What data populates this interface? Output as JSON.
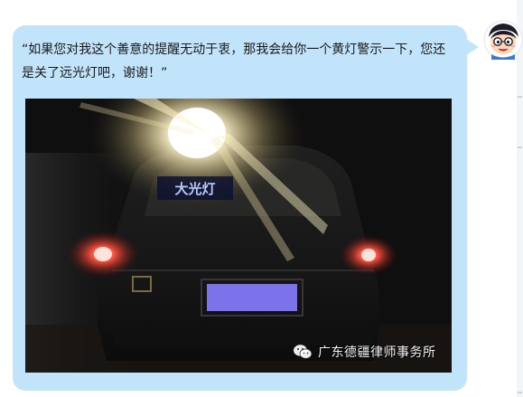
{
  "message": {
    "text": "“如果您对我这个善意的提醒无动于衷，那我会给你一个黄灯警示一下，您还是关了远光灯吧，谢谢！”"
  },
  "photo": {
    "rear_sign_text": "大光灯",
    "watermark_text": "广东德疆律师事务所",
    "watermark_icon": "wechat-icon"
  },
  "avatar": {
    "icon": "cartoon-avatar-icon"
  },
  "colors": {
    "bubble": "#c2e4fb",
    "page_background": "#ffffff",
    "plate_blur": "#7d73e8",
    "tail_light": "#ff4d3d",
    "headlight_glare": "#fff6cf"
  }
}
